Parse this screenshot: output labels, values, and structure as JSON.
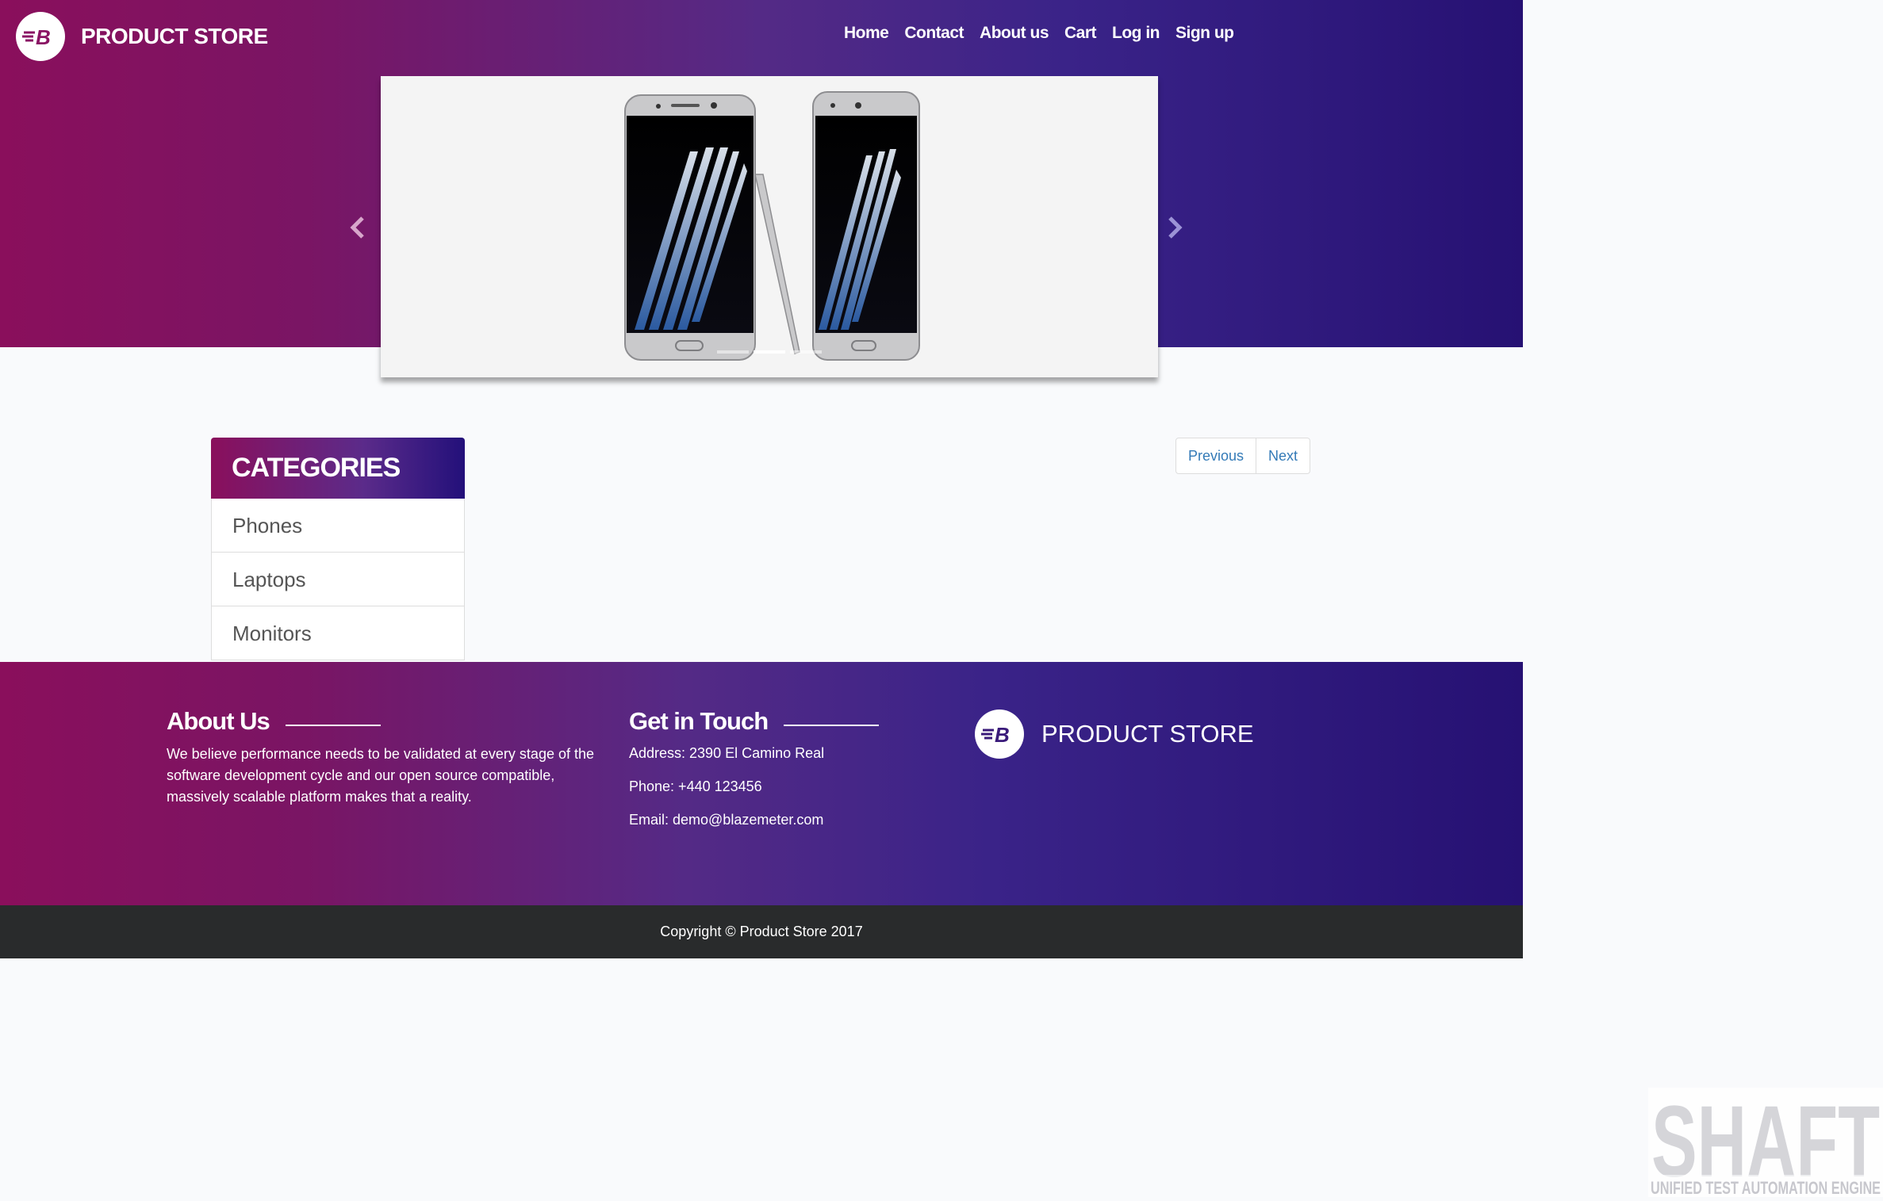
{
  "header": {
    "brand": "PRODUCT STORE",
    "nav": [
      "Home",
      "Contact",
      "About us",
      "Cart",
      "Log in",
      "Sign up"
    ]
  },
  "carousel": {
    "active_index": 1,
    "slide_count": 3,
    "prev_icon": "chevron-left-icon",
    "next_icon": "chevron-right-icon"
  },
  "categories": {
    "title": "CATEGORIES",
    "items": [
      "Phones",
      "Laptops",
      "Monitors"
    ]
  },
  "pagination": {
    "previous": "Previous",
    "next": "Next"
  },
  "footer": {
    "about_title": "About Us",
    "about_text": "We believe performance needs to be validated at every stage of the software development cycle and our open source compatible, massively scalable platform makes that a reality.",
    "contact_title": "Get in Touch",
    "address": "Address: 2390 El Camino Real",
    "phone": "Phone: +440 123456",
    "email": "Email: demo@blazemeter.com",
    "brand": "PRODUCT STORE",
    "copyright": "Copyright © Product Store 2017"
  },
  "watermark": {
    "title": "SHAFT",
    "subtitle": "UNIFIED TEST AUTOMATION ENGINE"
  },
  "colors": {
    "gradient_start": "#8a0f5c",
    "gradient_end": "#261173",
    "link": "#337ab7",
    "copyright_bg": "#292b2c"
  }
}
